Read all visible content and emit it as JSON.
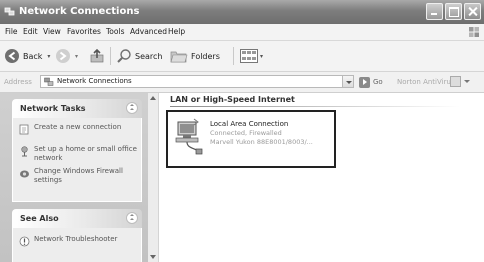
{
  "window": {
    "title": "Network Connections"
  },
  "menu": [
    "File",
    "Edit",
    "View",
    "Favorites",
    "Tools",
    "Advanced",
    "Help"
  ],
  "toolbar": {
    "back_label": "Back",
    "search_label": "Search",
    "folders_label": "Folders"
  },
  "address": {
    "label": "Address",
    "value": "Network Connections",
    "go_label": "Go",
    "extension_label": "Norton AntiVirus"
  },
  "task_panels": {
    "network_tasks": {
      "title": "Network Tasks",
      "items": [
        {
          "label": "Create a new connection",
          "icon": "new-connection-icon"
        },
        {
          "label": "Set up a home or small office network",
          "icon": "home-network-icon"
        },
        {
          "label": "Change Windows Firewall settings",
          "icon": "firewall-icon"
        }
      ]
    },
    "see_also": {
      "title": "See Also",
      "items": [
        {
          "label": "Network Troubleshooter",
          "icon": "troubleshooter-icon"
        }
      ]
    }
  },
  "content": {
    "group_heading": "LAN or High-Speed Internet",
    "connection": {
      "name": "Local Area Connection",
      "status": "Connected, Firewalled",
      "device": "Marvell Yukon 88E8001/8003/..."
    }
  }
}
